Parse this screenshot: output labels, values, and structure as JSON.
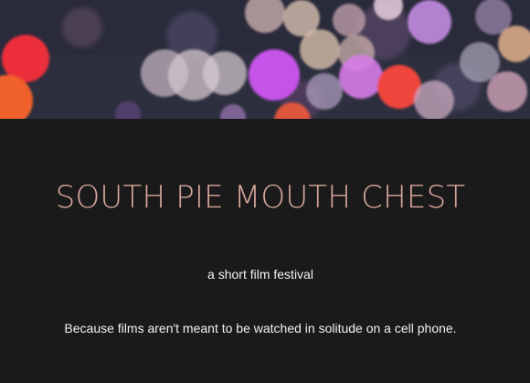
{
  "hero": {
    "image_description_icon": "bokeh-lights-image"
  },
  "header": {
    "title": "SOUTH PIE MOUTH CHEST",
    "subtitle": "a short film festival"
  },
  "main": {
    "tagline": "Because films aren't meant to be watched in solitude on a cell phone."
  },
  "colors": {
    "background": "#1b1a1b",
    "title": "#d6a79a",
    "text": "#f2f2f2"
  }
}
